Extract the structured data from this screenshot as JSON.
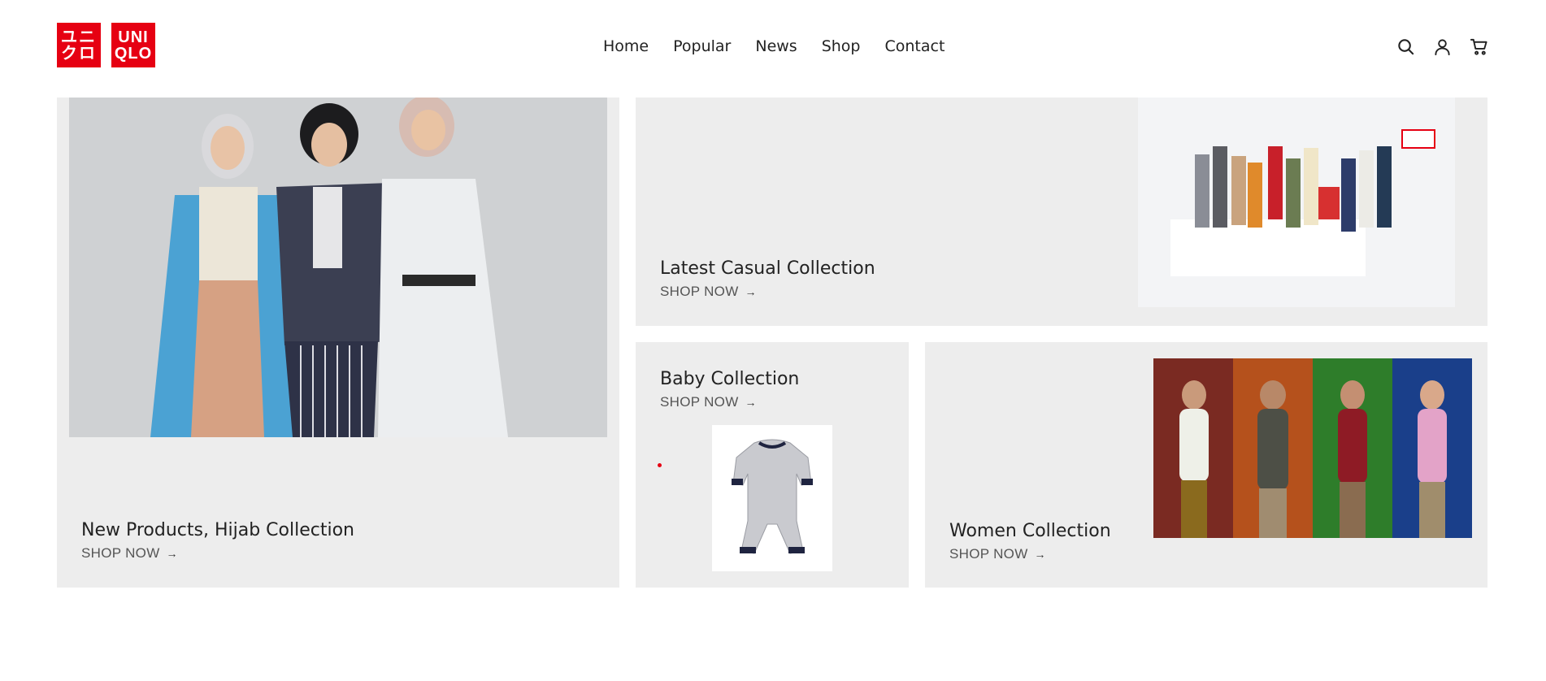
{
  "brand": {
    "logo_katakana_top": "ユニ",
    "logo_katakana_bottom": "クロ",
    "logo_latin_top": "UNI",
    "logo_latin_bottom": "QLO",
    "color": "#e60012"
  },
  "nav": {
    "items": [
      "Home",
      "Popular",
      "News",
      "Shop",
      "Contact"
    ]
  },
  "header_icons": [
    "search-icon",
    "user-icon",
    "cart-icon"
  ],
  "tiles": {
    "hijab": {
      "title": "New Products, Hijab Collection",
      "cta": "SHOP NOW"
    },
    "casual": {
      "title": "Latest Casual Collection",
      "cta": "SHOP NOW"
    },
    "baby": {
      "title": "Baby Collection",
      "cta": "SHOP NOW"
    },
    "women": {
      "title": "Women Collection",
      "cta": "SHOP NOW"
    }
  },
  "arrow_glyph": "→"
}
